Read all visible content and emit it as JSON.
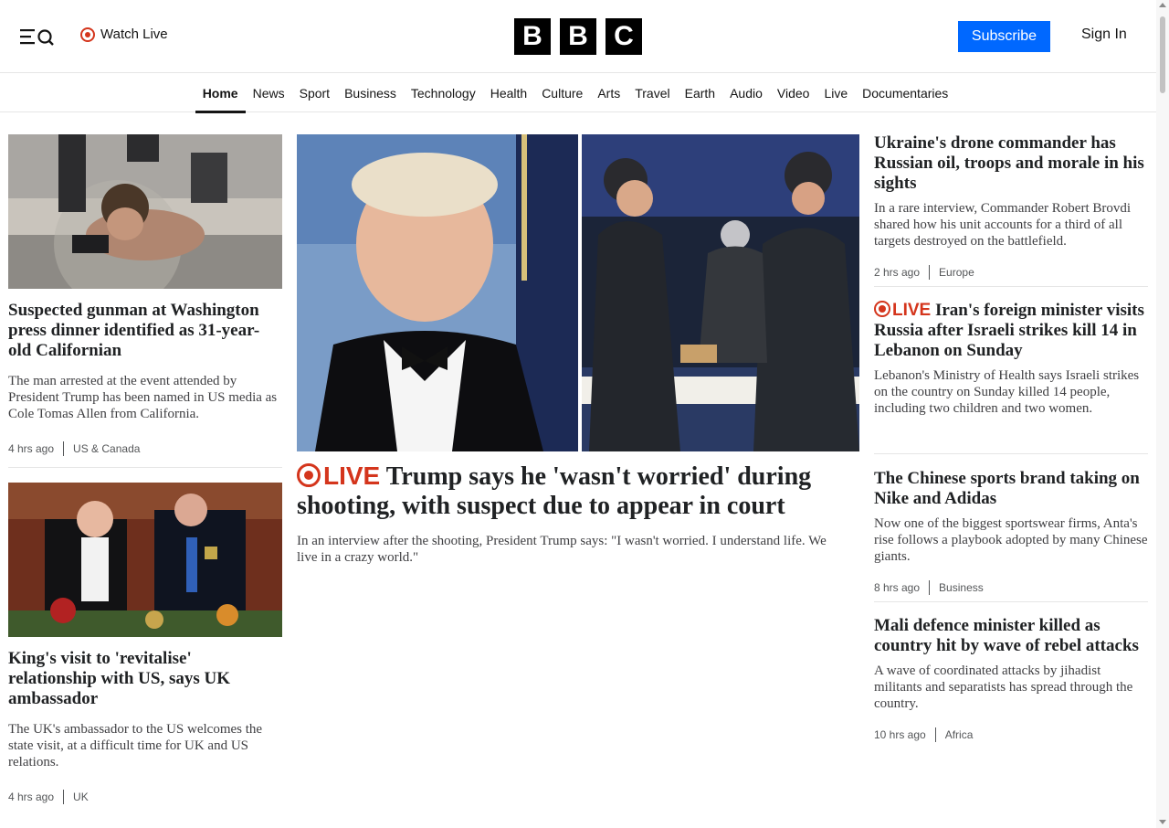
{
  "header": {
    "watch_live": "Watch Live",
    "logo_letters": [
      "B",
      "B",
      "C"
    ],
    "subscribe": "Subscribe",
    "sign_in": "Sign In"
  },
  "nav": {
    "items": [
      "Home",
      "News",
      "Sport",
      "Business",
      "Technology",
      "Health",
      "Culture",
      "Arts",
      "Travel",
      "Earth",
      "Audio",
      "Video",
      "Live",
      "Documentaries"
    ],
    "active": "Home"
  },
  "left": {
    "story1": {
      "headline": "Suspected gunman at Washington press dinner identified as 31-year-old Californian",
      "summary": "The man arrested at the event attended by President Trump has been named in US media as Cole Tomas Allen from California.",
      "time": "4 hrs ago",
      "section": "US & Canada"
    },
    "story2": {
      "headline": "King's visit to 'revitalise' relationship with US, says UK ambassador",
      "summary": "The UK's ambassador to the US welcomes the state visit, at a difficult time for UK and US relations.",
      "time": "4 hrs ago",
      "section": "UK"
    }
  },
  "center": {
    "live_label": "LIVE",
    "headline": "Trump says he 'wasn't worried' during shooting, with suspect due to appear in court",
    "summary": "In an interview after the shooting, President Trump says: \"I wasn't worried. I understand life. We live in a crazy world.\""
  },
  "right": {
    "story1": {
      "headline": "Ukraine's drone commander has Russian oil, troops and morale in his sights",
      "summary": "In a rare interview, Commander Robert Brovdi shared how his unit accounts for a third of all targets destroyed on the battlefield.",
      "time": "2 hrs ago",
      "section": "Europe"
    },
    "story2": {
      "live_label": "LIVE",
      "headline": "Iran's foreign minister visits Russia after Israeli strikes kill 14 in Lebanon on Sunday",
      "summary": "Lebanon's Ministry of Health says Israeli strikes on the country on Sunday killed 14 people, including two children and two women."
    },
    "story3": {
      "headline": "The Chinese sports brand taking on Nike and Adidas",
      "summary": "Now one of the biggest sportswear firms, Anta's rise follows a playbook adopted by many Chinese giants.",
      "time": "8 hrs ago",
      "section": "Business"
    },
    "story4": {
      "headline": "Mali defence minister killed as country hit by wave of rebel attacks",
      "summary": "A wave of coordinated attacks by jihadist militants and separatists has spread through the country.",
      "time": "10 hrs ago",
      "section": "Africa"
    }
  },
  "colors": {
    "live_red": "#d4351c",
    "subscribe_blue": "#0068ff",
    "text": "#141414"
  }
}
